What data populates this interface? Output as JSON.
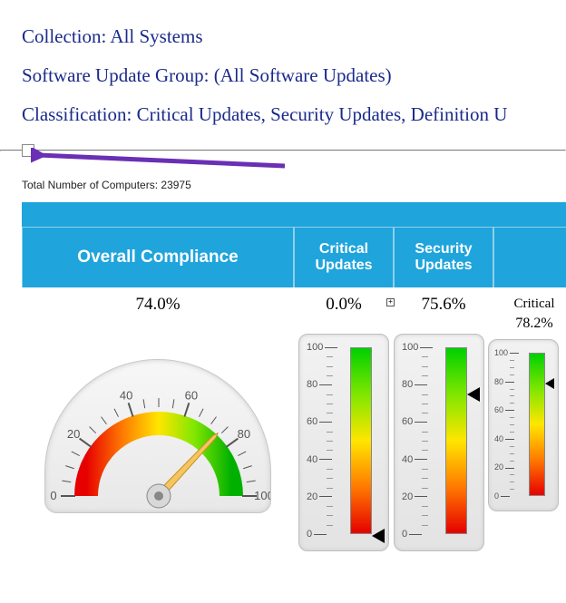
{
  "header": {
    "collection": "Collection: All Systems",
    "group": "Software Update Group: (All Software Updates)",
    "classification": "Classification: Critical Updates, Security Updates, Definition U"
  },
  "totals": {
    "label_prefix": "Total Number of Computers: ",
    "count": "23975"
  },
  "columns": {
    "overall": "Overall Compliance",
    "critical": "Critical Updates",
    "security": "Security Updates"
  },
  "values": {
    "overall_pct": "74.0%",
    "critical_pct": "0.0%",
    "security_pct": "75.6%",
    "extra_label": "Critical",
    "extra_pct": "78.2%"
  },
  "gauge_ticks": [
    "100",
    "80",
    "60",
    "40",
    "20",
    "0"
  ],
  "chart_data": [
    {
      "type": "gauge",
      "subtype": "radial-half",
      "title": "Overall Compliance",
      "range": [
        0,
        100
      ],
      "ticks": [
        0,
        20,
        40,
        60,
        80,
        100
      ],
      "value": 74.0,
      "color_stops": [
        [
          0,
          "#e60000"
        ],
        [
          25,
          "#ff7a00"
        ],
        [
          50,
          "#ffe600"
        ],
        [
          75,
          "#7fe600"
        ],
        [
          100,
          "#00d000"
        ]
      ]
    },
    {
      "type": "gauge",
      "subtype": "linear-vertical",
      "title": "Critical Updates",
      "range": [
        0,
        100
      ],
      "ticks": [
        0,
        20,
        40,
        60,
        80,
        100
      ],
      "value": 0.0
    },
    {
      "type": "gauge",
      "subtype": "linear-vertical",
      "title": "Security Updates",
      "range": [
        0,
        100
      ],
      "ticks": [
        0,
        20,
        40,
        60,
        80,
        100
      ],
      "value": 75.6
    },
    {
      "type": "gauge",
      "subtype": "linear-vertical",
      "title": "Critical",
      "range": [
        0,
        100
      ],
      "ticks": [
        0,
        20,
        40,
        60,
        80,
        100
      ],
      "value": 78.2
    }
  ]
}
